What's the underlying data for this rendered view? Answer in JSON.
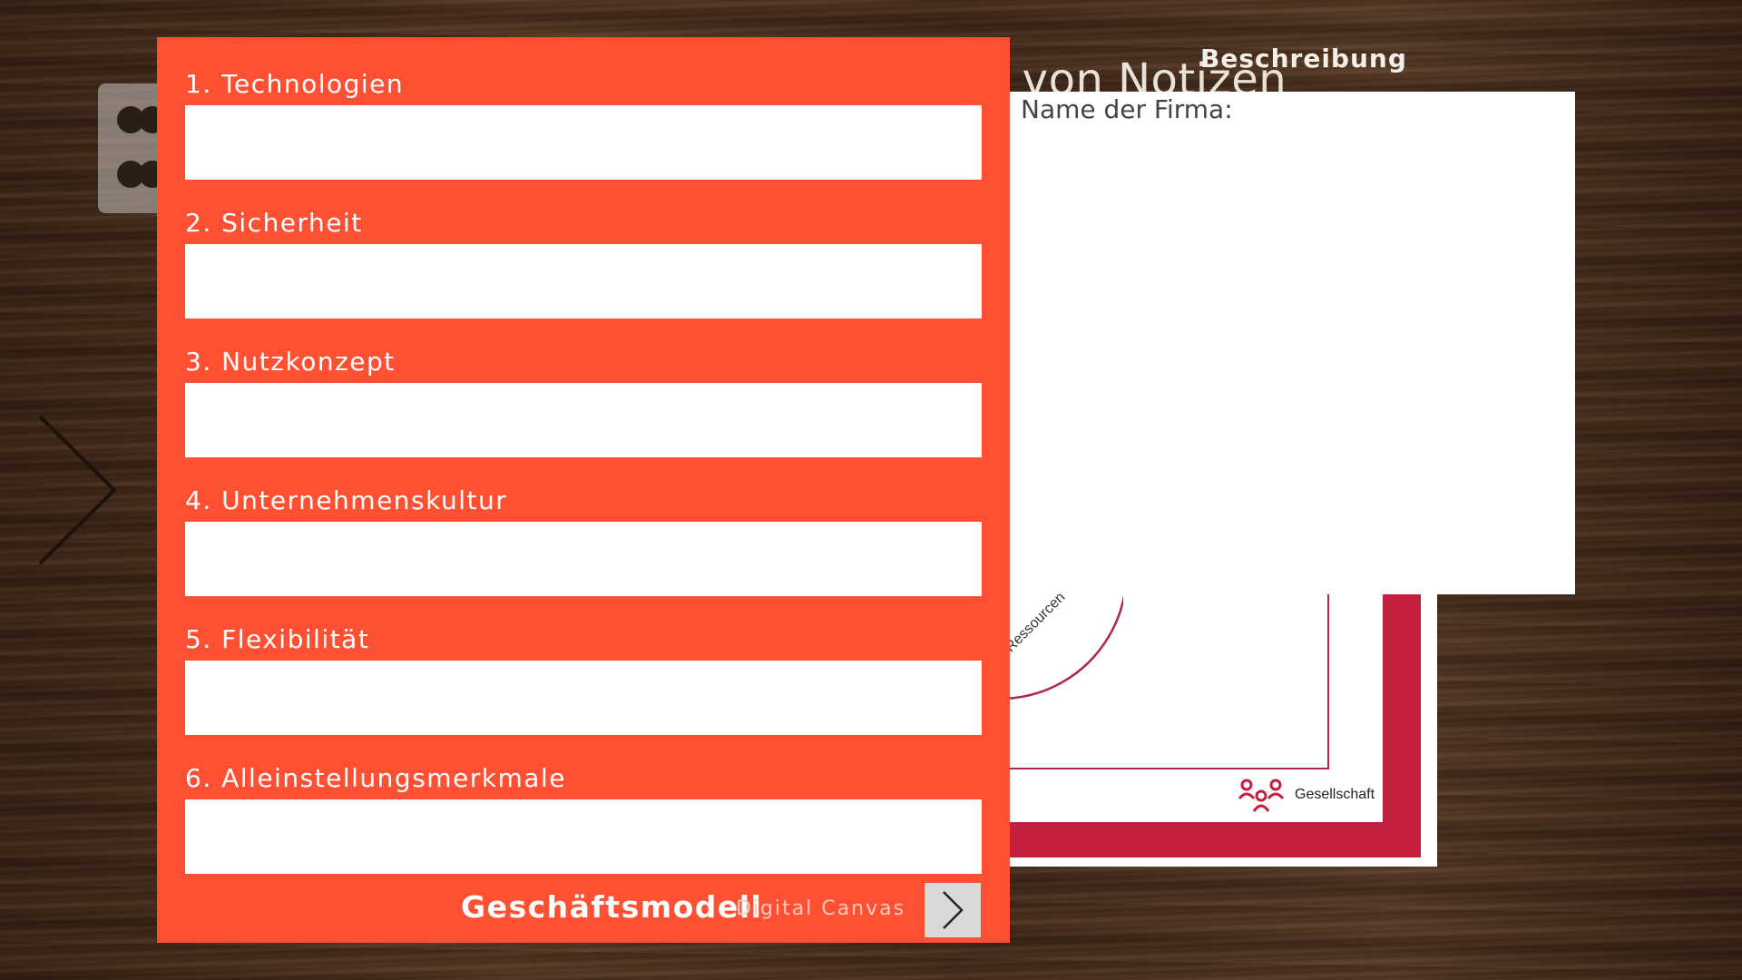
{
  "background": {
    "title": "n von Notizen",
    "description_label": "Beschreibung"
  },
  "description_panel": {
    "label": "Name der Firma:"
  },
  "canvas": {
    "ressourcen": "Ressourcen",
    "gesellschaft": "Gesellschaft",
    "accent_color": "#c41f3e"
  },
  "form": {
    "background_color": "#ff5033",
    "fields": [
      {
        "label": "1. Technologien",
        "value": ""
      },
      {
        "label": "2. Sicherheit",
        "value": ""
      },
      {
        "label": "3. Nutzkonzept",
        "value": ""
      },
      {
        "label": "4. Unternehmenskultur",
        "value": ""
      },
      {
        "label": "5. Flexibilität",
        "value": ""
      },
      {
        "label": "6. Alleinstellungsmerkmale",
        "value": ""
      }
    ],
    "footer_title": "Geschäftsmodell",
    "footer_subtitle": "Digital Canvas",
    "next_icon": "chevron-right-icon"
  },
  "icons": {
    "menu": "grid-dots-icon",
    "left_nav": "chevron-right-icon",
    "people": "people-icon"
  }
}
